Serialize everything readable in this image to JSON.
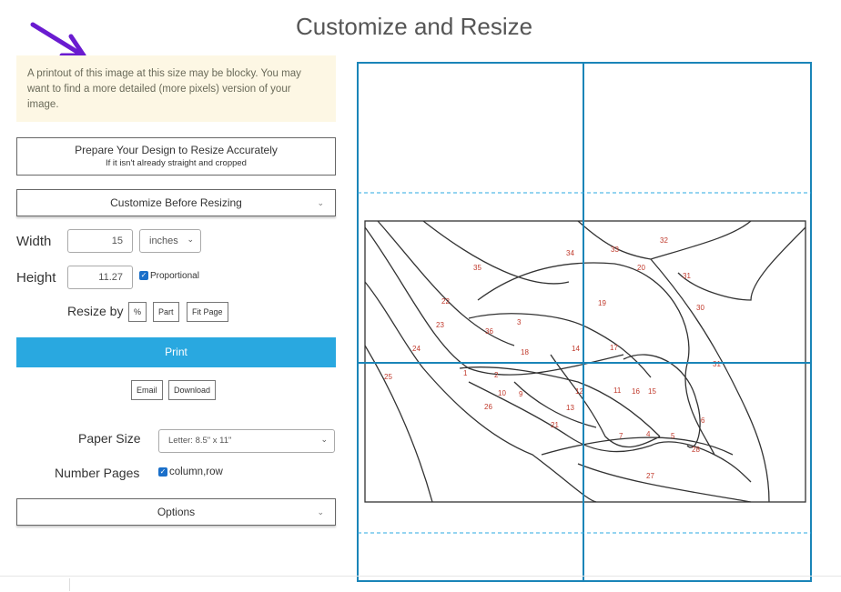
{
  "title": "Customize and Resize",
  "notice": "A printout of this image at this size may be blocky. You may want to find a more detailed (more pixels) version of your image.",
  "prepare": {
    "title": "Prepare Your Design to Resize Accurately",
    "subtitle": "If it isn't already straight and cropped"
  },
  "customize_label": "Customize Before Resizing",
  "width": {
    "label": "Width",
    "value": "15",
    "unit": "inches"
  },
  "height": {
    "label": "Height",
    "value": "11.27",
    "proportional_label": "Proportional",
    "proportional_checked": true
  },
  "resize_by": {
    "label": "Resize by",
    "options": [
      "%",
      "Part",
      "Fit Page"
    ]
  },
  "print_label": "Print",
  "email_label": "Email",
  "download_label": "Download",
  "paper_size": {
    "label": "Paper Size",
    "value": "Letter: 8.5\" x 11\""
  },
  "number_pages": {
    "label": "Number Pages",
    "value": "column,row",
    "checked": true
  },
  "options_label": "Options",
  "preview": {
    "grid_color": "#1a85b8",
    "piece_numbers": [
      "35",
      "34",
      "33",
      "32",
      "20",
      "31",
      "30",
      "19",
      "22",
      "23",
      "36",
      "3",
      "18",
      "14",
      "17",
      "24",
      "25",
      "31",
      "1",
      "2",
      "10",
      "9",
      "12",
      "13",
      "11",
      "16",
      "15",
      "26",
      "21",
      "7",
      "4",
      "5",
      "6",
      "28",
      "27"
    ]
  },
  "colors": {
    "accent": "#29a8e0",
    "notice_bg": "#fdf7e4",
    "arrow": "#6a1bd0",
    "piece_number": "#c0392b"
  }
}
